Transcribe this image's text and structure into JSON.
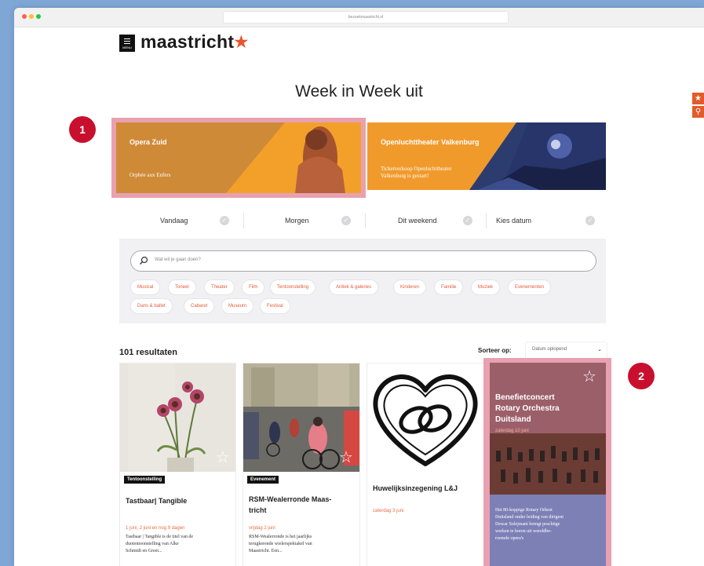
{
  "browser": {
    "url": "bezoekmaastricht.nl"
  },
  "header": {
    "menu_label": "MENU",
    "logo_text": "maastricht",
    "logo_star": "★"
  },
  "side_tabs": [
    {
      "icon": "star-icon",
      "glyph": "★"
    },
    {
      "icon": "search-icon",
      "glyph": "⚲"
    }
  ],
  "page_title": "Week in Week uit",
  "annotations": {
    "badge_1": "1",
    "badge_2": "2"
  },
  "banners": [
    {
      "title": "Opera Zuid",
      "subtitle": "Orphée aux Enfers"
    },
    {
      "title": "Openluchttheater Valkenburg",
      "subtitle_line1": "Ticketverkoop Openluchttheater",
      "subtitle_line2": "Valkenburg is gestart!"
    }
  ],
  "filter_tabs": [
    {
      "label": "Vandaag",
      "check": "✓"
    },
    {
      "label": "Morgen",
      "check": "✓"
    },
    {
      "label": "Dit weekend",
      "check": "✓"
    },
    {
      "label": "Kies datum",
      "check": "✓"
    }
  ],
  "search": {
    "placeholder": "Wat wil je gaan doen?"
  },
  "categories": [
    "Musical",
    "Toneel",
    "Theater",
    "Film",
    "Tentoonstelling",
    "Antiek & galeries",
    "Kinderen",
    "Familie",
    "Muziek",
    "Evenementen",
    "Dans & ballet",
    "Cabaret",
    "Museum",
    "Festival"
  ],
  "results": {
    "count_label": "101 resultaten",
    "sort_label": "Sorteer op:",
    "sort_value": "Datum oplopend"
  },
  "cards": [
    {
      "category": "Tentoonstelling",
      "title": "Tastbaar| Tangible",
      "date": "1 juni, 2 juni en nog 9 dagen",
      "desc_lines": [
        "Tastbaar | Tangible is de titel van de",
        "duotentoonstelling van Alke",
        "Schmidt en Greet..."
      ]
    },
    {
      "category": "Evenement",
      "title_lines": [
        "RSM-Wealerronde Maas-",
        "tricht"
      ],
      "date": "vrijdag 2 juni",
      "desc_lines": [
        "RSM-Wealerronde is het jaarlijks",
        "terugkerende wielerspektakel van",
        "Maastricht. Een..."
      ]
    },
    {
      "title": "Huwelijksinzegening L&J",
      "date": "zaterdag 3 juni"
    },
    {
      "title_lines": [
        "Benefietconcert",
        "Rotary Orchestra",
        "Duitsland"
      ],
      "date": "zaterdag 10 juni",
      "desc_lines": [
        "Het 80-koppige Rotary Orkest",
        "Duitsland onder leiding van dirigent",
        "Dewar Sulejmani brengt prachtige",
        "werken te horen uit wereldbe-",
        "roemde opera's"
      ]
    }
  ],
  "colors": {
    "accent": "#e8562f",
    "badge": "#c8102e",
    "highlight": "#e8a1b0",
    "banner_orange": "#f09a2c"
  }
}
